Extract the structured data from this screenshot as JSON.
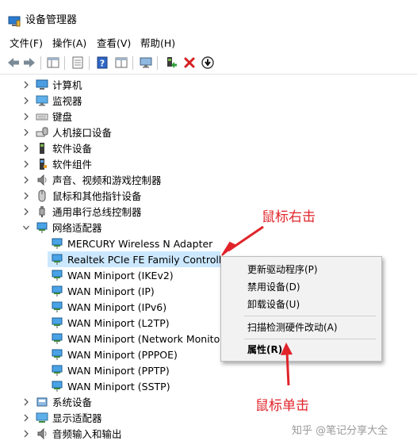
{
  "window": {
    "title": "设备管理器"
  },
  "menu": [
    "文件(F)",
    "操作(A)",
    "查看(V)",
    "帮助(H)"
  ],
  "tree": {
    "categories_top": [
      "计算机",
      "监视器",
      "键盘",
      "人机接口设备",
      "软件设备",
      "软件组件",
      "声音、视频和游戏控制器",
      "鼠标和其他指针设备",
      "通用串行总线控制器"
    ],
    "network": {
      "label": "网络适配器",
      "children": [
        "MERCURY Wireless N Adapter",
        "Realtek PCIe FE Family Controller",
        "WAN Miniport (IKEv2)",
        "WAN Miniport (IP)",
        "WAN Miniport (IPv6)",
        "WAN Miniport (L2TP)",
        "WAN Miniport (Network Monitor)",
        "WAN Miniport (PPPOE)",
        "WAN Miniport (PPTP)",
        "WAN Miniport (SSTP)"
      ]
    },
    "categories_bottom": [
      "系统设备",
      "显示适配器",
      "音频输入和输出"
    ]
  },
  "context_menu": {
    "update_driver": "更新驱动程序(P)",
    "disable": "禁用设备(D)",
    "uninstall": "卸载设备(U)",
    "scan": "扫描检测硬件改动(A)",
    "properties": "属性(R)"
  },
  "annotations": {
    "right_click": "鼠标右击",
    "left_click": "鼠标单击"
  },
  "watermark": "知乎 @笔记分享大全",
  "colors": {
    "selection": "#cce8ff",
    "annotation": "#e0242a",
    "menu_bg": "#f2f2f2"
  }
}
